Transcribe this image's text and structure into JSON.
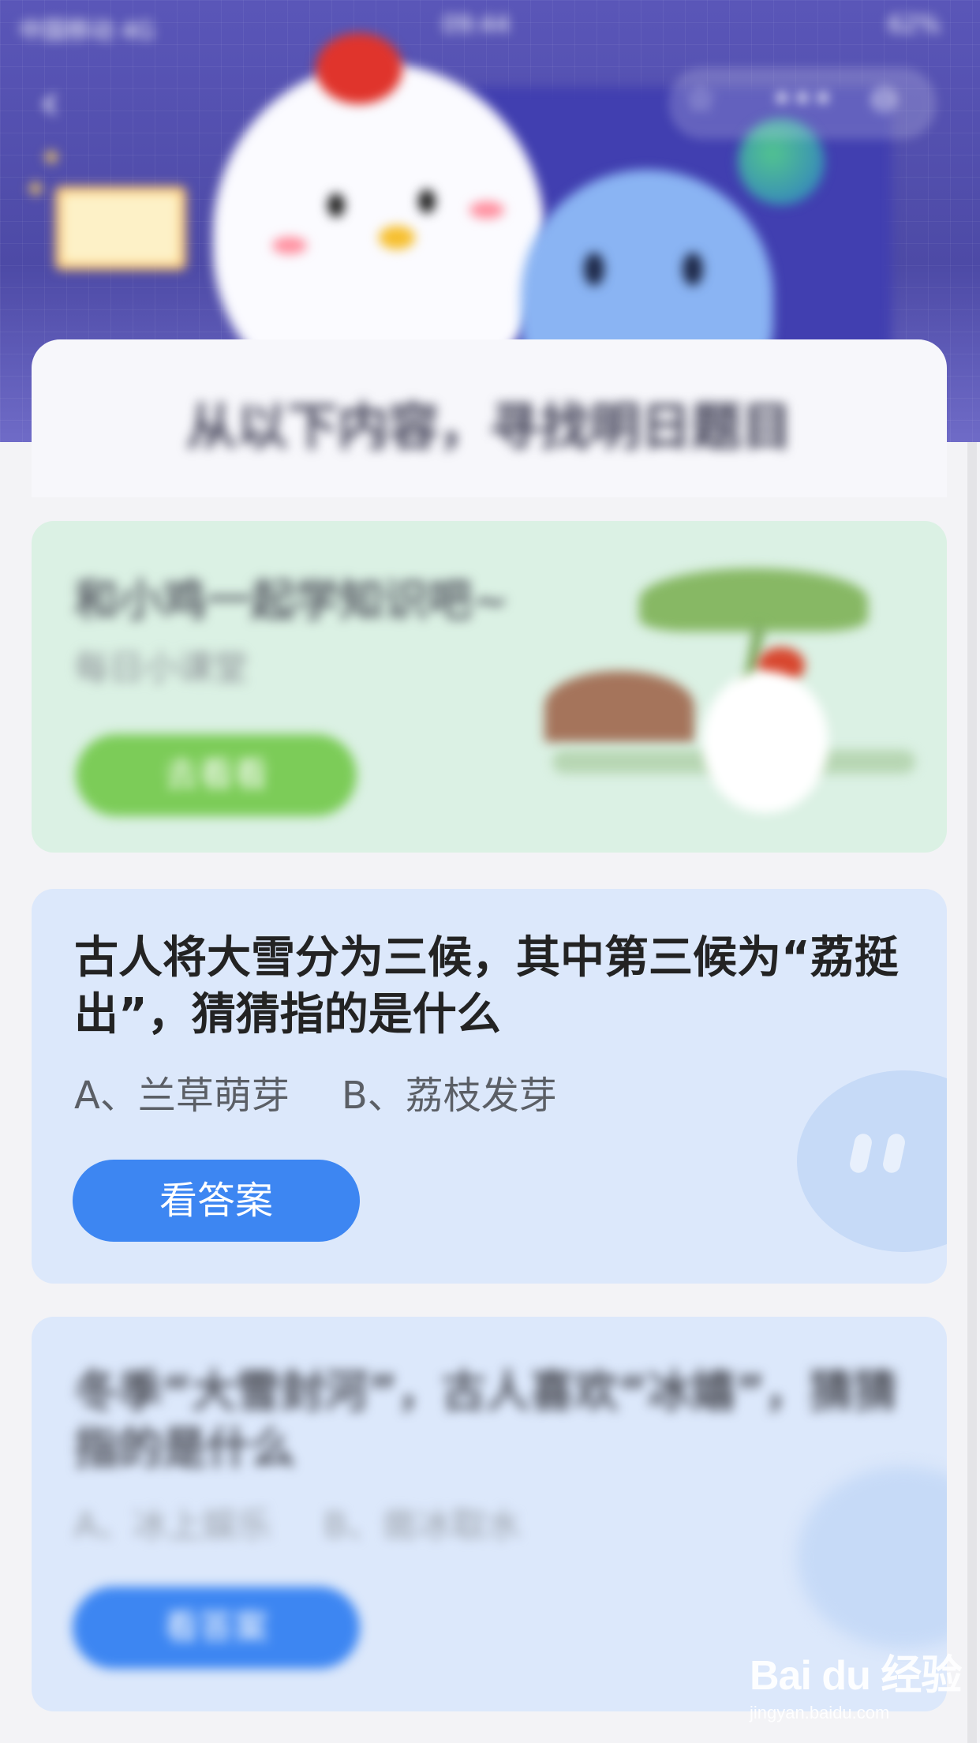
{
  "status_bar": {
    "carrier": "中国移动 4G",
    "time": "09:44",
    "battery": "62%"
  },
  "header": {
    "back_icon": "chevron-left-icon",
    "capsule_icons": [
      "star-icon",
      "more-icon",
      "close-icon"
    ],
    "title": "从以下内容，寻找明日题目"
  },
  "promo_card": {
    "title": "和小鸡一起学知识吧~",
    "subtitle": "每日小课堂",
    "button_label": "去看看"
  },
  "question_card": {
    "question": "古人将大雪分为三候，其中第三候为“荔挺出”，猜猜指的是什么",
    "option_a": "A、兰草萌芽",
    "option_b": "B、荔枝发芽",
    "button_label": "看答案"
  },
  "question_card_2": {
    "question": "冬季“大雪封河”，古人喜欢“冰嬉”，猜猜指的是什么",
    "option_a": "A、冰上娱乐",
    "option_b": "B、凿冰取水",
    "button_label": "看答案"
  },
  "watermark": {
    "logo": "Bai du 经验",
    "url": "jingyan.baidu.com"
  },
  "colors": {
    "banner": "#5a56b8",
    "answer_button": "#3d86f2",
    "promo_button": "#7ccc58",
    "question_card_bg": "#dce8fb",
    "promo_card_bg": "#dbf1e4"
  }
}
